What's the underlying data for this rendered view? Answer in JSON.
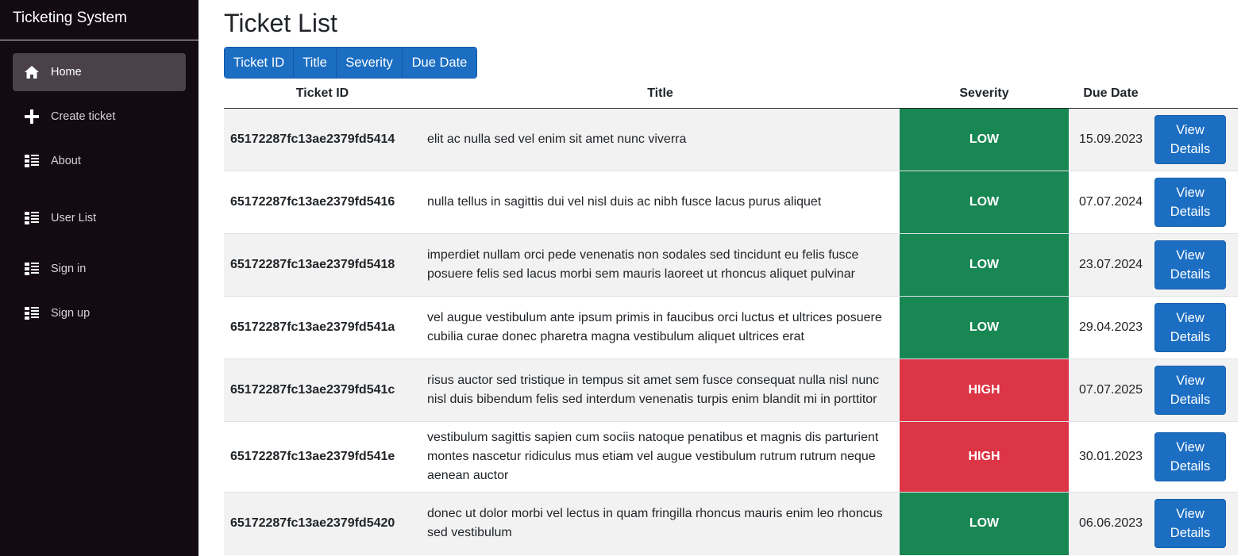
{
  "app": {
    "title": "Ticketing System"
  },
  "nav": [
    {
      "label": "Home",
      "icon": "home-icon",
      "active": true
    },
    {
      "label": "Create ticket",
      "icon": "plus-icon"
    },
    {
      "label": "About",
      "icon": "list-icon"
    },
    {
      "label": "User List",
      "icon": "list-icon"
    },
    {
      "label": "Sign in",
      "icon": "list-icon"
    },
    {
      "label": "Sign up",
      "icon": "list-icon"
    }
  ],
  "page": {
    "title": "Ticket List"
  },
  "sort_buttons": [
    "Ticket ID",
    "Title",
    "Severity",
    "Due Date"
  ],
  "table": {
    "headers": [
      "Ticket ID",
      "Title",
      "Severity",
      "Due Date",
      ""
    ],
    "view_label": "View Details",
    "rows": [
      {
        "id": "65172287fc13ae2379fd5414",
        "title": "elit ac nulla sed vel enim sit amet nunc viverra",
        "severity": "LOW",
        "due": "15.09.2023"
      },
      {
        "id": "65172287fc13ae2379fd5416",
        "title": "nulla tellus in sagittis dui vel nisl duis ac nibh fusce lacus purus aliquet",
        "severity": "LOW",
        "due": "07.07.2024"
      },
      {
        "id": "65172287fc13ae2379fd5418",
        "title": "imperdiet nullam orci pede venenatis non sodales sed tincidunt eu felis fusce posuere felis sed lacus morbi sem mauris laoreet ut rhoncus aliquet pulvinar",
        "severity": "LOW",
        "due": "23.07.2024"
      },
      {
        "id": "65172287fc13ae2379fd541a",
        "title": "vel augue vestibulum ante ipsum primis in faucibus orci luctus et ultrices posuere cubilia curae donec pharetra magna vestibulum aliquet ultrices erat",
        "severity": "LOW",
        "due": "29.04.2023"
      },
      {
        "id": "65172287fc13ae2379fd541c",
        "title": "risus auctor sed tristique in tempus sit amet sem fusce consequat nulla nisl nunc nisl duis bibendum felis sed interdum venenatis turpis enim blandit mi in porttitor",
        "severity": "HIGH",
        "due": "07.07.2025"
      },
      {
        "id": "65172287fc13ae2379fd541e",
        "title": "vestibulum sagittis sapien cum sociis natoque penatibus et magnis dis parturient montes nascetur ridiculus mus etiam vel augue vestibulum rutrum rutrum neque aenean auctor",
        "severity": "HIGH",
        "due": "30.01.2023"
      },
      {
        "id": "65172287fc13ae2379fd5420",
        "title": "donec ut dolor morbi vel lectus in quam fringilla rhoncus mauris enim leo rhoncus sed vestibulum",
        "severity": "LOW",
        "due": "06.06.2023"
      }
    ]
  },
  "colors": {
    "sidebar": "#140a12",
    "accent": "#1b6ec2",
    "low": "#198754",
    "high": "#dc3545"
  }
}
